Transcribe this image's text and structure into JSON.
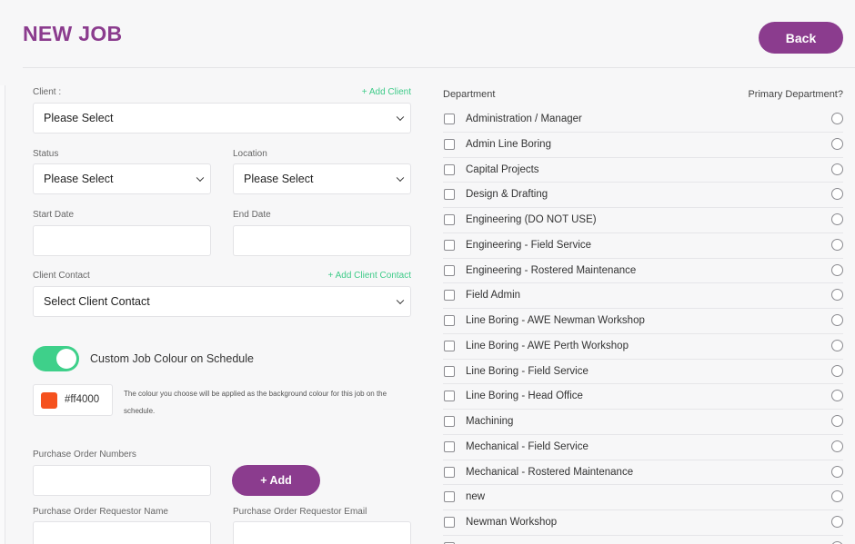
{
  "page": {
    "title": "NEW JOB",
    "back_label": "Back"
  },
  "form": {
    "client": {
      "label": "Client :",
      "add_link": "+ Add Client",
      "value": "Please Select"
    },
    "status": {
      "label": "Status",
      "value": "Please Select"
    },
    "location": {
      "label": "Location",
      "value": "Please Select"
    },
    "start_date": {
      "label": "Start Date",
      "value": ""
    },
    "end_date": {
      "label": "End Date",
      "value": ""
    },
    "client_contact": {
      "label": "Client Contact",
      "add_link": "+ Add Client Contact",
      "value": "Select Client Contact"
    },
    "custom_colour": {
      "label": "Custom Job Colour on Schedule",
      "enabled": true,
      "hex": "#ff4000",
      "swatch_color": "#f5511e",
      "note": "The colour you choose will be applied as the background colour for this job on the schedule."
    },
    "po_numbers": {
      "label": "Purchase Order Numbers",
      "value": "",
      "add_label": "+ Add"
    },
    "po_requestor_name": {
      "label": "Purchase Order Requestor Name",
      "value": ""
    },
    "po_requestor_email": {
      "label": "Purchase Order Requestor Email",
      "value": ""
    }
  },
  "departments": {
    "header": "Department",
    "primary_header": "Primary Department?",
    "items": [
      {
        "label": "Administration / Manager"
      },
      {
        "label": "Admin Line Boring"
      },
      {
        "label": "Capital Projects"
      },
      {
        "label": "Design & Drafting"
      },
      {
        "label": "Engineering (DO NOT USE)"
      },
      {
        "label": "Engineering - Field Service"
      },
      {
        "label": "Engineering - Rostered Maintenance"
      },
      {
        "label": "Field Admin"
      },
      {
        "label": "Line Boring - AWE Newman Workshop"
      },
      {
        "label": "Line Boring - AWE Perth Workshop"
      },
      {
        "label": "Line Boring - Field Service"
      },
      {
        "label": "Line Boring - Head Office"
      },
      {
        "label": "Machining"
      },
      {
        "label": "Mechanical - Field Service"
      },
      {
        "label": "Mechanical - Rostered Maintenance"
      },
      {
        "label": "new"
      },
      {
        "label": "Newman Workshop"
      },
      {
        "label": ""
      }
    ]
  },
  "colors": {
    "accent": "#8b3c8e",
    "link": "#3fcb89",
    "toggle_on": "#3ed08a"
  }
}
